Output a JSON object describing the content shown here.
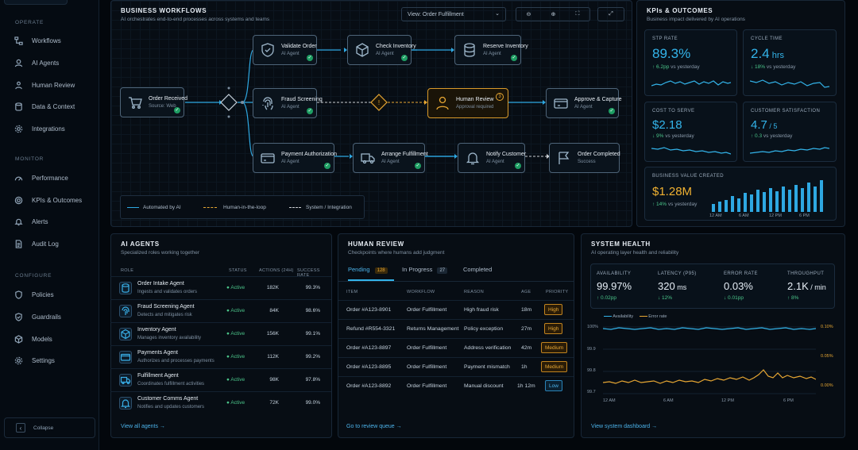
{
  "sidebar": {
    "sections": [
      {
        "title": "OPERATE",
        "items": [
          "Workflows",
          "AI Agents",
          "Human Review",
          "Data & Context",
          "Integrations"
        ]
      },
      {
        "title": "MONITOR",
        "items": [
          "Performance",
          "KPIs & Outcomes",
          "Alerts",
          "Audit Log"
        ]
      },
      {
        "title": "CONFIGURE",
        "items": [
          "Policies",
          "Guardrails",
          "Models",
          "Settings"
        ]
      }
    ],
    "collapse_label": "Collapse"
  },
  "workflows": {
    "title": "BUSINESS WORKFLOWS",
    "subtitle": "AI orchestrates end-to-end processes across systems and teams",
    "view_select": "View: Order Fulfillment",
    "nodes": {
      "order_received": {
        "title": "Order Received",
        "sub": "Source: Web"
      },
      "validate_order": {
        "title": "Validate Order",
        "sub": "AI Agent"
      },
      "check_inventory": {
        "title": "Check Inventory",
        "sub": "AI Agent"
      },
      "reserve_inventory": {
        "title": "Reserve Inventory",
        "sub": "AI Agent"
      },
      "fraud_screening": {
        "title": "Fraud Screening",
        "sub": "AI Agent"
      },
      "human_review": {
        "title": "Human Review",
        "sub": "Approval required",
        "badge": "3"
      },
      "approve_capture": {
        "title": "Approve & Capture",
        "sub": "AI Agent"
      },
      "payment_authorization": {
        "title": "Payment Authorization",
        "sub": "AI Agent"
      },
      "arrange_fulfillment": {
        "title": "Arrange Fulfillment",
        "sub": "AI Agent"
      },
      "notify_customer": {
        "title": "Notify Customer",
        "sub": "AI Agent"
      },
      "order_completed": {
        "title": "Order Completed",
        "sub": "Success"
      }
    },
    "legend": {
      "automated": "Automated by AI",
      "human": "Human-in-the-loop",
      "system": "System / Integration"
    }
  },
  "kpis": {
    "title": "KPIs & OUTCOMES",
    "subtitle": "Business impact delivered by AI operations",
    "stp": {
      "label": "STP RATE",
      "value": "89.3%",
      "unit": "",
      "delta": "↑ 6.2pp",
      "note": "vs yesterday"
    },
    "cycle": {
      "label": "CYCLE TIME",
      "value": "2.4",
      "unit": " hrs",
      "delta": "↓ 18%",
      "note": "vs yesterday"
    },
    "cost": {
      "label": "COST TO SERVE",
      "value": "$2.18",
      "unit": "",
      "delta": "↓ 9%",
      "note": "vs yesterday"
    },
    "csat": {
      "label": "CUSTOMER SATISFACTION",
      "value": "4.7",
      "unit": " / 5",
      "delta": "↑ 0.3",
      "note": "vs yesterday"
    },
    "value": {
      "label": "BUSINESS VALUE CREATED",
      "value": "$1.28M",
      "delta": "↑ 14%",
      "note": "vs yesterday",
      "axis": [
        "12 AM",
        "6 AM",
        "12 PM",
        "6 PM"
      ]
    }
  },
  "agents": {
    "title": "AI AGENTS",
    "subtitle": "Specialized roles working together",
    "headers": {
      "role": "ROLE",
      "status": "STATUS",
      "actions": "ACTIONS (24H)",
      "success": "SUCCESS RATE"
    },
    "rows": [
      {
        "name": "Order Intake Agent",
        "desc": "Ingests and validates orders",
        "status": "● Active",
        "actions": "182K",
        "success": "99.3%"
      },
      {
        "name": "Fraud Screening Agent",
        "desc": "Detects and mitigates risk",
        "status": "● Active",
        "actions": "84K",
        "success": "98.6%"
      },
      {
        "name": "Inventory Agent",
        "desc": "Manages inventory availability",
        "status": "● Active",
        "actions": "156K",
        "success": "99.1%"
      },
      {
        "name": "Payments Agent",
        "desc": "Authorizes and processes payments",
        "status": "● Active",
        "actions": "112K",
        "success": "99.2%"
      },
      {
        "name": "Fulfillment Agent",
        "desc": "Coordinates fulfillment activities",
        "status": "● Active",
        "actions": "98K",
        "success": "97.8%"
      },
      {
        "name": "Customer Comms Agent",
        "desc": "Notifies and updates customers",
        "status": "● Active",
        "actions": "72K",
        "success": "99.0%"
      }
    ],
    "link": "View all agents →"
  },
  "review": {
    "title": "HUMAN REVIEW",
    "subtitle": "Checkpoints where humans add judgment",
    "tabs": [
      {
        "label": "Pending",
        "count": "128"
      },
      {
        "label": "In Progress",
        "count": "27"
      },
      {
        "label": "Completed",
        "count": ""
      }
    ],
    "headers": {
      "item": "ITEM",
      "workflow": "WORKFLOW",
      "reason": "REASON",
      "age": "AGE",
      "priority": "PRIORITY"
    },
    "rows": [
      {
        "item": "Order #A123-8901",
        "workflow": "Order Fulfillment",
        "reason": "High fraud risk",
        "age": "18m",
        "priority": "High"
      },
      {
        "item": "Refund #R554-3321",
        "workflow": "Returns Management",
        "reason": "Policy exception",
        "age": "27m",
        "priority": "High"
      },
      {
        "item": "Order #A123-8897",
        "workflow": "Order Fulfillment",
        "reason": "Address verification",
        "age": "42m",
        "priority": "Medium"
      },
      {
        "item": "Order #A123-8895",
        "workflow": "Order Fulfillment",
        "reason": "Payment mismatch",
        "age": "1h",
        "priority": "Medium"
      },
      {
        "item": "Order #A123-8892",
        "workflow": "Order Fulfillment",
        "reason": "Manual discount",
        "age": "1h 12m",
        "priority": "Low"
      }
    ],
    "link": "Go to review queue →"
  },
  "health": {
    "title": "SYSTEM HEALTH",
    "subtitle": "AI operating layer health and reliability",
    "stats": [
      {
        "label": "AVAILABILITY",
        "value": "99.97%",
        "unit": "",
        "delta": "↑ 0.02pp"
      },
      {
        "label": "LATENCY (P95)",
        "value": "320",
        "unit": " ms",
        "delta": "↓ 12%"
      },
      {
        "label": "ERROR RATE",
        "value": "0.03%",
        "unit": "",
        "delta": "↓ 0.01pp"
      },
      {
        "label": "THROUGHPUT",
        "value": "2.1K",
        "unit": " / min",
        "delta": "↑ 8%"
      }
    ],
    "legend": {
      "availability": "Availability",
      "error": "Error rate"
    },
    "y_left": [
      "100%",
      "99.9",
      "99.8",
      "99.7"
    ],
    "y_right": [
      "0.10%",
      "0.05%",
      "0.00%"
    ],
    "x": [
      "12 AM",
      "6 AM",
      "12 PM",
      "6 PM"
    ],
    "link": "View system dashboard →"
  },
  "colors": {
    "accent": "#33b4ea",
    "human": "#e7a733",
    "success": "#4bc58a",
    "value": "#f0b131"
  }
}
